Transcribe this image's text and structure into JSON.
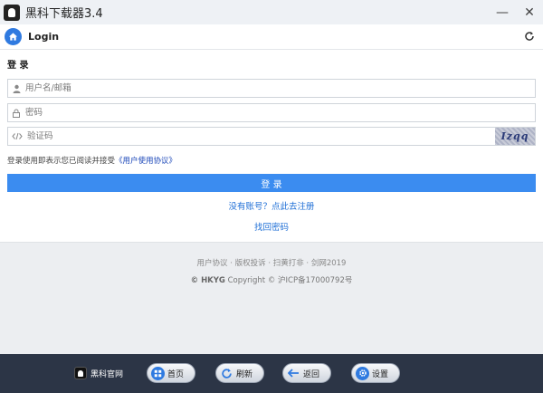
{
  "app": {
    "title": "黑科下载器3.4"
  },
  "window_controls": {
    "minimize": "—",
    "close": "✕"
  },
  "header": {
    "title": "Login"
  },
  "login": {
    "section_title": "登 录",
    "username_placeholder": "用户名/邮箱",
    "password_placeholder": "密码",
    "captcha_placeholder": "验证码",
    "captcha_text": "Izqq",
    "agree_text": "登录使用即表示您已阅读并接受",
    "agree_link": "《用户使用协议》",
    "submit_label": "登 录",
    "register_link": "没有账号？点此去注册",
    "forgot_link": "找回密码"
  },
  "footer": {
    "links": "用户协议 · 版权投诉 · 扫黄打非 · 剑网2019",
    "copyright_brand": "© HKYG",
    "copyright_rest": "Copyright © 沪ICP备17000792号"
  },
  "bottom_bar": {
    "brand": "黑科官网",
    "buttons": [
      {
        "label": "首页",
        "icon": "home-icon"
      },
      {
        "label": "刷新",
        "icon": "refresh-icon"
      },
      {
        "label": "返回",
        "icon": "back-arrow-icon"
      },
      {
        "label": "设置",
        "icon": "gear-icon"
      }
    ]
  },
  "colors": {
    "accent": "#3b8cf0",
    "bottom_bar": "#2c3546",
    "link": "#1f6fd6"
  }
}
